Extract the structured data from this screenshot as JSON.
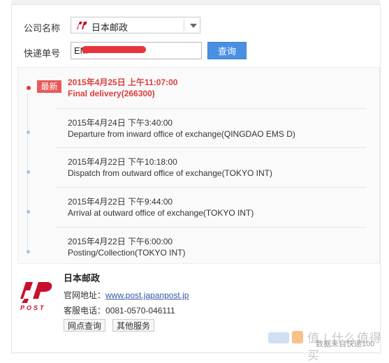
{
  "form": {
    "company_label": "公司名称",
    "company_value": "日本邮政",
    "tracking_label": "快递单号",
    "tracking_value": "EM",
    "query_button": "查询"
  },
  "timeline": {
    "latest_badge": "最新",
    "events": [
      {
        "time": "2015年4月25日 上午11:07:00",
        "desc": "Final delivery(266300)"
      },
      {
        "time": "2015年4月24日 下午3:40:00",
        "desc": "Departure from inward office of exchange(QINGDAO EMS D)"
      },
      {
        "time": "2015年4月22日 下午10:18:00",
        "desc": "Dispatch from outward office of exchange(TOKYO INT)"
      },
      {
        "time": "2015年4月22日 下午9:44:00",
        "desc": "Arrival at outward office of exchange(TOKYO INT)"
      },
      {
        "time": "2015年4月22日 下午6:00:00",
        "desc": "Posting/Collection(TOKYO INT)"
      }
    ]
  },
  "carrier": {
    "name": "日本邮政",
    "website_label": "官网地址：",
    "website": "www.post.japanpost.jp",
    "phone_label": "客服电话：",
    "phone": "0081-0570-046111",
    "btn_outlets": "网点查询",
    "btn_other": "其他服务",
    "logo_text": "POST"
  },
  "watermark": {
    "site_text": "值 | 什么值得买",
    "source_text": "数据来自快递100"
  },
  "colors": {
    "accent_blue": "#4a90e2",
    "latest_red": "#e03c3c",
    "brand_red": "#c8102e"
  },
  "icons": {
    "select_caret": "chevron-down-icon",
    "carrier_logo": "japan-post-logo"
  }
}
